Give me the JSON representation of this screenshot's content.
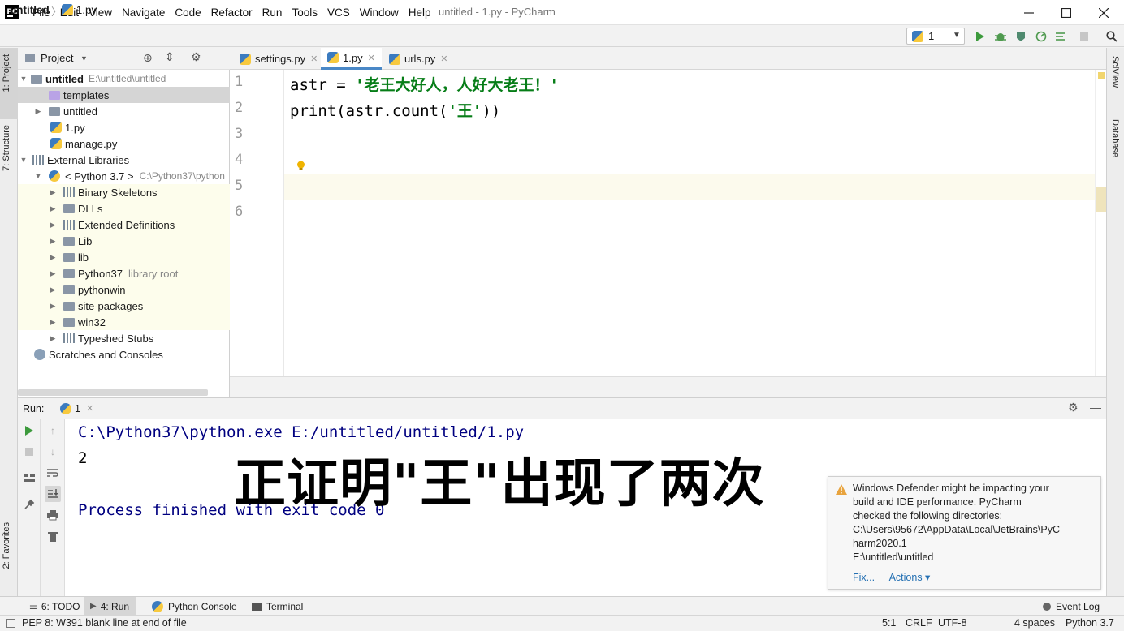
{
  "titlebar": {
    "logo": "PC",
    "menu": [
      "File",
      "Edit",
      "View",
      "Navigate",
      "Code",
      "Refactor",
      "Run",
      "Tools",
      "VCS",
      "Window",
      "Help"
    ],
    "window_title": "untitled - 1.py - PyCharm"
  },
  "navbar": {
    "project": "untitled",
    "file": "1.py",
    "run_config": "1"
  },
  "left_strip": {
    "project_tab": "1: Project",
    "structure_tab": "7: Structure",
    "favorites_tab": "2: Favorites"
  },
  "right_strip": {
    "sciview_tab": "SciView",
    "database_tab": "Database"
  },
  "project_panel": {
    "title": "Project",
    "tree": [
      {
        "label": "untitled",
        "hint": "E:\\untitled\\untitled"
      },
      {
        "label": "templates"
      },
      {
        "label": "untitled"
      },
      {
        "label": "1.py"
      },
      {
        "label": "manage.py"
      },
      {
        "label": "External Libraries"
      },
      {
        "label": "< Python 3.7 >",
        "hint": "C:\\Python37\\python"
      },
      {
        "label": "Binary Skeletons"
      },
      {
        "label": "DLLs"
      },
      {
        "label": "Extended Definitions"
      },
      {
        "label": "Lib"
      },
      {
        "label": "lib"
      },
      {
        "label": "Python37",
        "hint": "library root"
      },
      {
        "label": "pythonwin"
      },
      {
        "label": "site-packages"
      },
      {
        "label": "win32"
      },
      {
        "label": "Typeshed Stubs"
      },
      {
        "label": "Scratches and Consoles"
      }
    ]
  },
  "editor": {
    "tabs": [
      "settings.py",
      "1.py",
      "urls.py"
    ],
    "active_tab": "1.py",
    "line_numbers": [
      "1",
      "2",
      "3",
      "4",
      "5",
      "6"
    ],
    "line1_a": "astr = ",
    "line1_str": "'老王大好人，人好大老王！'",
    "line2_a": "print(astr.count(",
    "line2_str": "'王'",
    "line2_b": "))"
  },
  "run_panel": {
    "label": "Run:",
    "tab": "1",
    "cmd": "C:\\Python37\\python.exe E:/untitled/untitled/1.py",
    "output": "2",
    "finished": "Process finished with exit code 0",
    "overlay": "正证明\"王\"出现了两次"
  },
  "notification": {
    "message_lines": [
      "Windows Defender might be impacting your",
      "build and IDE performance. PyCharm",
      "checked the following directories:",
      "C:\\Users\\95672\\AppData\\Local\\JetBrains\\PyC",
      "harm2020.1",
      "E:\\untitled\\untitled"
    ],
    "fix": "Fix...",
    "actions": "Actions ▾"
  },
  "toolwindows": {
    "todo": "6: TODO",
    "run": "4: Run",
    "python_console": "Python Console",
    "terminal": "Terminal",
    "event_log": "Event Log"
  },
  "status": {
    "message": "PEP 8: W391 blank line at end of file",
    "position": "5:1",
    "line_sep": "CRLF",
    "encoding": "UTF-8",
    "indent": "4 spaces",
    "interpreter": "Python 3.7"
  },
  "colors": {
    "accent": "#4a88c7",
    "string": "#067d17",
    "console_blue": "#000080",
    "caret_line": "#fcfaed",
    "lib_highlight": "#fdfdec"
  }
}
